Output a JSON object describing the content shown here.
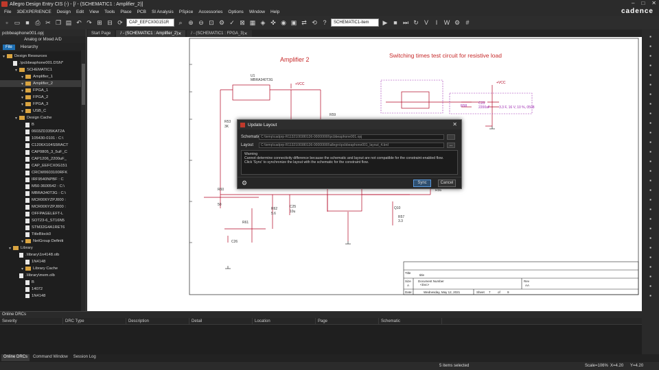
{
  "app": {
    "title": "Allegro Design Entry CIS (-) - [/ - (SCHEMATIC1 : Amplifier_2)]",
    "brand": "cadence"
  },
  "menu": [
    "File",
    "3DEXPERIENCE",
    "Design",
    "Edit",
    "View",
    "Tools",
    "Place",
    "PCB",
    "SI Analysis",
    "PSpice",
    "Accessories",
    "Options",
    "Window",
    "Help"
  ],
  "toolbar": {
    "part_select": "CAP_EEFCX0G151R",
    "view_select": "SCHEMATIC1-item"
  },
  "left_panel": {
    "project_file": "pcbbeaphone001.opj",
    "subtitle": "Analog or Mixed A/D",
    "tabs": [
      "File",
      "Hierarchy"
    ],
    "tree": [
      {
        "label": "Design Resources",
        "indent": 0,
        "icon": "folder"
      },
      {
        "label": ".\\pcbbeaphone001.DSN*",
        "indent": 1,
        "icon": "doc"
      },
      {
        "label": "SCHEMATIC1",
        "indent": 2,
        "icon": "folder"
      },
      {
        "label": "Amplifier_1",
        "indent": 3,
        "icon": "folder"
      },
      {
        "label": "Amplifier_2",
        "indent": 3,
        "icon": "folder"
      },
      {
        "label": "FPGA_1",
        "indent": 3,
        "icon": "folder"
      },
      {
        "label": "FPGA_2",
        "indent": 3,
        "icon": "folder"
      },
      {
        "label": "FPGA_3",
        "indent": 3,
        "icon": "folder"
      },
      {
        "label": "USB_C",
        "indent": 3,
        "icon": "folder"
      },
      {
        "label": "Design Cache",
        "indent": 2,
        "icon": "folder"
      },
      {
        "label": "B",
        "indent": 3,
        "icon": "doc"
      },
      {
        "label": "0603ZD335KAT2A",
        "indent": 3,
        "icon": "doc"
      },
      {
        "label": "105430-0101 : C:\\",
        "indent": 3,
        "icon": "doc"
      },
      {
        "label": "C1206X104S5RACT",
        "indent": 3,
        "icon": "doc"
      },
      {
        "label": "CAP0805_3_5uF_C",
        "indent": 3,
        "icon": "doc"
      },
      {
        "label": "CAP1206_2200uF_",
        "indent": 3,
        "icon": "doc"
      },
      {
        "label": "CAP_EEFCX0G151",
        "indent": 3,
        "icon": "doc"
      },
      {
        "label": "CRCW0603100RFK",
        "indent": 3,
        "icon": "doc"
      },
      {
        "label": "IRF9540NPBF : C",
        "indent": 3,
        "icon": "doc"
      },
      {
        "label": "M50-3600542 : C:\\",
        "indent": 3,
        "icon": "doc"
      },
      {
        "label": "MBRA340T3G : C:\\",
        "indent": 3,
        "icon": "doc"
      },
      {
        "label": "MCR006YZPJ000 :",
        "indent": 3,
        "icon": "doc"
      },
      {
        "label": "MCR006YZPJ000 :",
        "indent": 3,
        "icon": "doc"
      },
      {
        "label": "OFFPAGELEFT-L",
        "indent": 3,
        "icon": "doc"
      },
      {
        "label": "SOT23-6_ST16N5",
        "indent": 3,
        "icon": "doc"
      },
      {
        "label": "STM32G4A1RET6",
        "indent": 3,
        "icon": "doc"
      },
      {
        "label": "TitleBlock0",
        "indent": 3,
        "icon": "doc"
      },
      {
        "label": "NetGroup Definiti",
        "indent": 3,
        "icon": "folder"
      },
      {
        "label": "Library",
        "indent": 1,
        "icon": "folder"
      },
      {
        "label": ".\\library\\1n4148.olb",
        "indent": 2,
        "icon": "doc"
      },
      {
        "label": "1N4148",
        "indent": 3,
        "icon": "doc"
      },
      {
        "label": "Library Cache",
        "indent": 3,
        "icon": "folder"
      },
      {
        "label": ".\\library\\mem.olb",
        "indent": 2,
        "icon": "doc"
      },
      {
        "label": "B",
        "indent": 3,
        "icon": "doc"
      },
      {
        "label": "14072",
        "indent": 3,
        "icon": "doc"
      },
      {
        "label": "1N4148",
        "indent": 3,
        "icon": "doc"
      }
    ]
  },
  "doc_tabs": [
    "Start Page",
    "/ - (SCHEMATIC1 : Amplifier_2)",
    "/ - (SCHEMATIC1 : FPGA_3)"
  ],
  "schematic": {
    "title_left": "Amplifier 2",
    "title_right": "Switching times test circuit for resistive load",
    "vcc": "+VCC",
    "u_ref": "U1",
    "u_part": "MBRA340T3G",
    "labels": [
      "R53",
      "3K",
      "R59",
      "R60",
      "50",
      "R61",
      "R62",
      "5.6",
      "C24",
      "C25",
      "10u",
      "C26",
      "R56",
      "R57",
      "3.3",
      "Q10",
      "R58",
      "50",
      "C23",
      "2200uF",
      "3.3 F, 16 V, 10 %, 0508"
    ],
    "title_block": {
      "title_label": "Title",
      "title": "title",
      "size_label": "Size",
      "size": "A",
      "docnum_label": "Document Number",
      "docnum": "<Doc>",
      "rev_label": "Rev",
      "rev": "AA",
      "date_label": "Date:",
      "date": "Wednesday, May 12, 2021",
      "sheet_label": "Sheet",
      "sheet": "7",
      "of": "of",
      "total": "9"
    }
  },
  "dialog": {
    "title": "Update Layout",
    "schematic_label": "Schematic",
    "schematic_path": "C:\\temp\\cadprp-R1132100380136-00000000\\pcbbeaphone001.opj",
    "layout_label": "Layout",
    "layout_path": "C:\\temp\\cadprp-R1132100380136-00000000\\allegro\\pcbbeaphone001_layout_4.brd",
    "browse": "...",
    "warning_title": "Warning",
    "warning_text_1": "Cannot determine connectivity difference because the schematic and layout are not compatible for the constraint-enabled flow.",
    "warning_text_2": "Click 'Sync' to synchronize the layout with the schematic for the constraint flow.",
    "sync_label": "Sync",
    "cancel_label": "Cancel"
  },
  "drc": {
    "header": "Online DRCs",
    "columns": [
      "Severity",
      "DRC Type",
      "Description",
      "Detail",
      "Location",
      "Page",
      "Schematic"
    ]
  },
  "bottom_tabs": [
    "Online DRCs",
    "Command Window",
    "Session Log"
  ],
  "status": {
    "selection": "5 items selected",
    "scale": "Scale=106%",
    "x": "X=4.20",
    "y": "Y=4.20"
  }
}
